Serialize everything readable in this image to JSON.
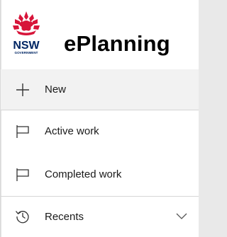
{
  "brand": {
    "logo_text": "NSW",
    "logo_subtext": "GOVERNMENT",
    "app_title": "ePlanning"
  },
  "nav": {
    "new_label": "New",
    "active_work_label": "Active work",
    "completed_work_label": "Completed work",
    "recents_label": "Recents"
  },
  "colors": {
    "nsw_red": "#d7153a",
    "nsw_navy": "#002664",
    "selected_bg": "#f2f2f2",
    "divider": "#d6d6d6"
  }
}
